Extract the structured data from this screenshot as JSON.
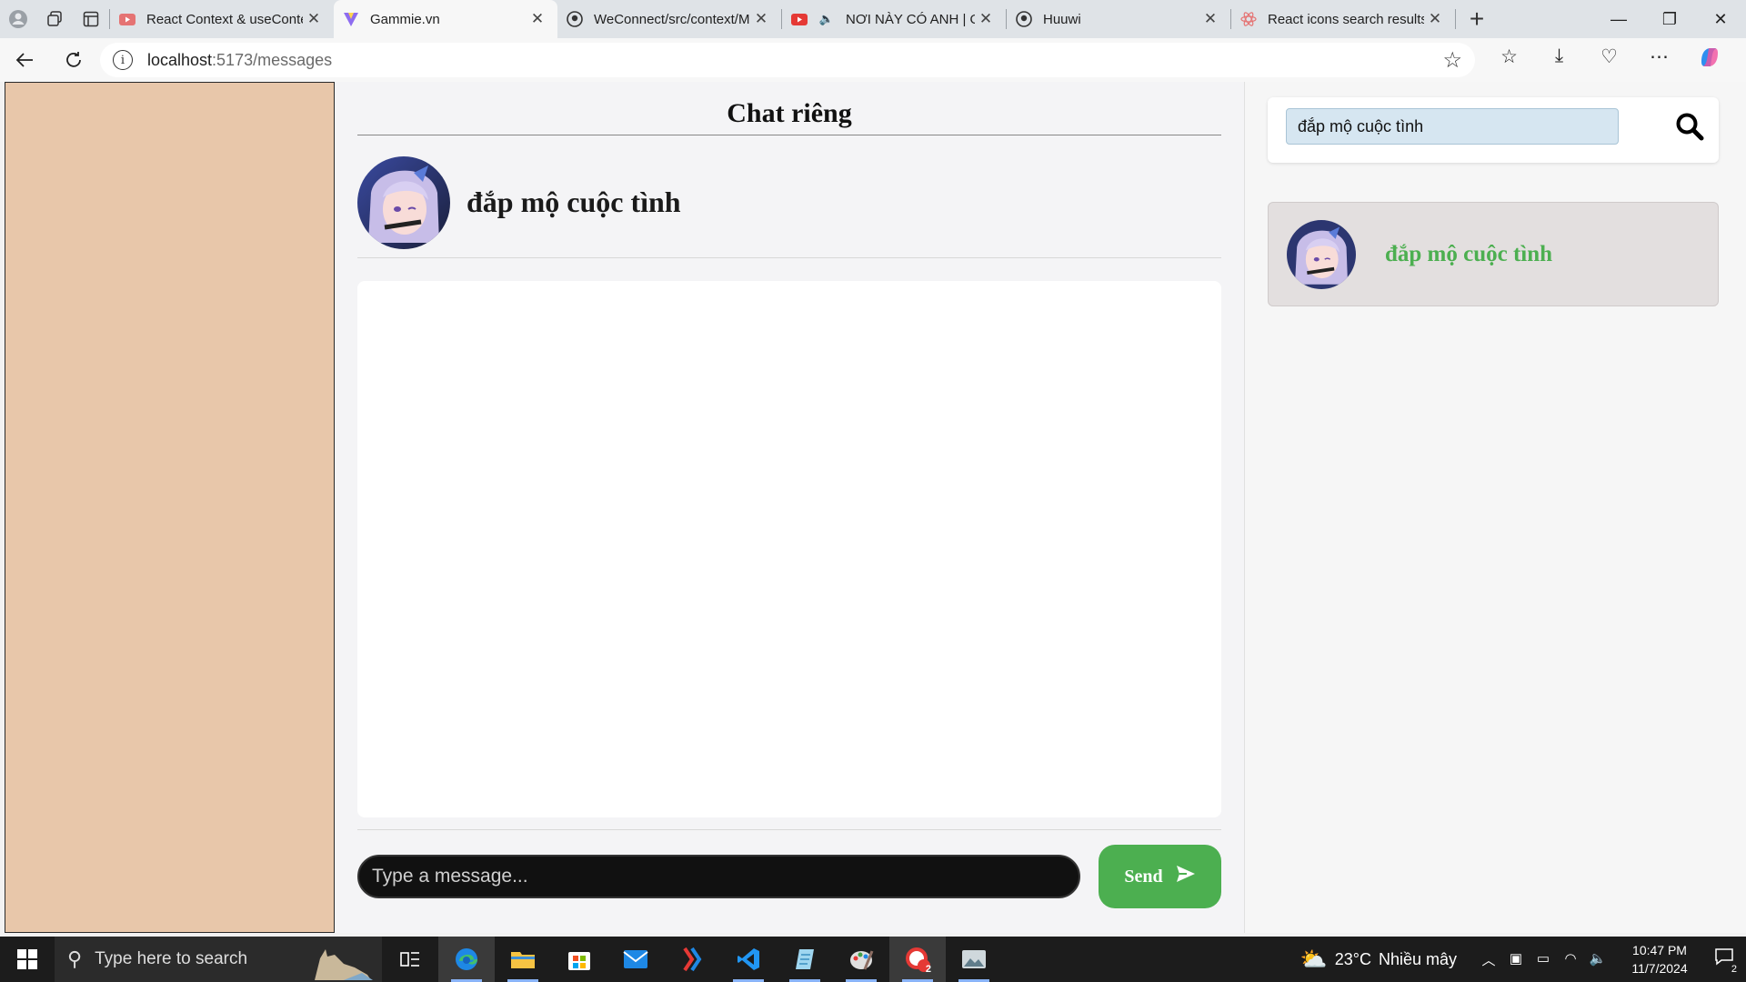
{
  "browser": {
    "tabs": [
      {
        "title": "React Context & useConte",
        "icon": "youtube-icon",
        "active": false
      },
      {
        "title": "Gammie.vn",
        "icon": "vite-icon",
        "active": true
      },
      {
        "title": "WeConnect/src/context/M",
        "icon": "github-icon",
        "active": false
      },
      {
        "title": "NƠI NÀY CÓ ANH | O",
        "icon": "youtube-icon",
        "active": false
      },
      {
        "title": "Huuwi",
        "icon": "github-icon",
        "active": false
      },
      {
        "title": "React icons search results",
        "icon": "react-icons-icon",
        "active": false
      }
    ],
    "url_host": "localhost",
    "url_path": ":5173/messages"
  },
  "chat": {
    "heading": "Chat riêng",
    "partner_name": "đắp mộ cuộc tình",
    "input_placeholder": "Type a message...",
    "send_label": "Send"
  },
  "sidebar_right": {
    "search_value": "đắp mộ cuộc tình",
    "results": [
      {
        "name": "đắp mộ cuộc tình"
      }
    ]
  },
  "colors": {
    "left_panel": "#e8c7aa",
    "accent_green": "#4caf50",
    "search_bg": "#d6e6f1"
  },
  "taskbar": {
    "search_placeholder": "Type here to search",
    "weather_temp": "23°C",
    "weather_text": "Nhiều mây",
    "time": "10:47 PM",
    "date": "11/7/2024",
    "notification_count": "2",
    "app_badge": "2"
  }
}
